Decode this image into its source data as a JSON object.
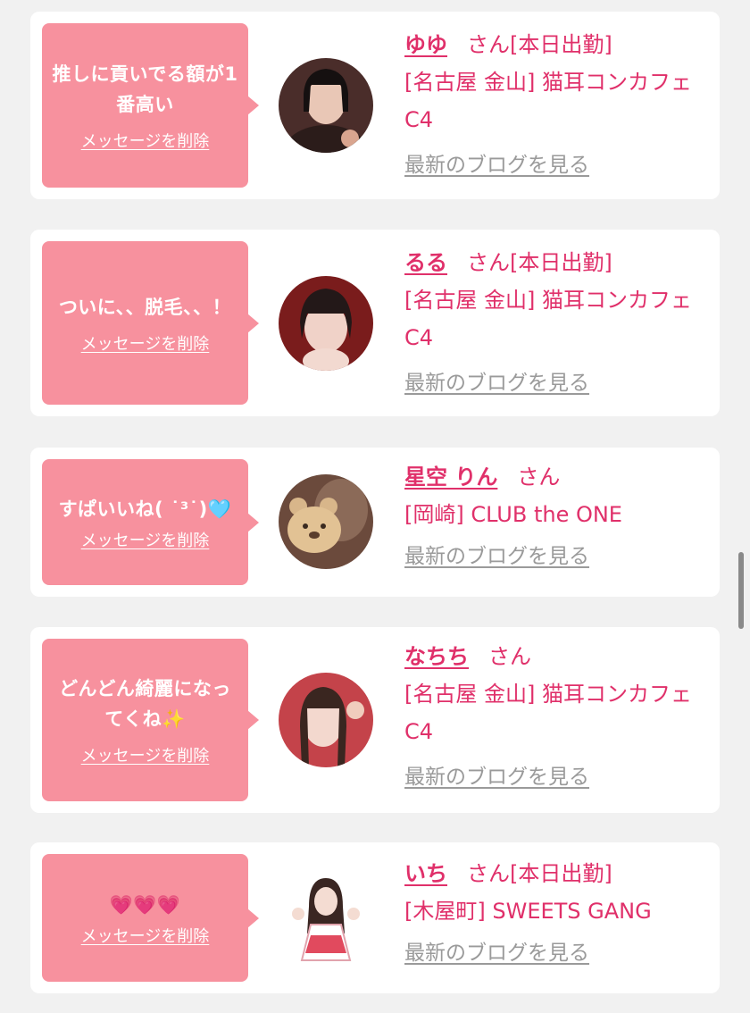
{
  "cards": [
    {
      "message": "推しに貢いでる額が1番高い",
      "delete_label": "メッセージを削除",
      "name": "ゆゆ",
      "san": "さん",
      "status": "[本日出勤]",
      "shop": "[名古屋 金山] 猫耳コンカフェ C4",
      "blog_label": "最新のブログを見る"
    },
    {
      "message": "ついに、、脱毛、、！",
      "delete_label": "メッセージを削除",
      "name": "るる",
      "san": "さん",
      "status": "[本日出勤]",
      "shop": "[名古屋 金山] 猫耳コンカフェ C4",
      "blog_label": "最新のブログを見る"
    },
    {
      "message": "すぱいいね( ˙³˙)🩵",
      "delete_label": "メッセージを削除",
      "name": "星空 りん",
      "san": "さん",
      "status": "",
      "shop": "[岡崎] CLUB the ONE",
      "blog_label": "最新のブログを見る"
    },
    {
      "message": "どんどん綺麗になってくね✨",
      "delete_label": "メッセージを削除",
      "name": "なちち",
      "san": "さん",
      "status": "",
      "shop": "[名古屋 金山] 猫耳コンカフェ C4",
      "blog_label": "最新のブログを見る"
    },
    {
      "message": "💗💗💗",
      "delete_label": "メッセージを削除",
      "name": "いち",
      "san": "さん",
      "status": "[本日出勤]",
      "shop": "[木屋町] SWEETS GANG",
      "blog_label": "最新のブログを見る"
    }
  ],
  "colors": {
    "accent": "#e0306a",
    "bubble": "#f7919e",
    "link_gray": "#9a9a9a",
    "background": "#f1f1f1"
  }
}
